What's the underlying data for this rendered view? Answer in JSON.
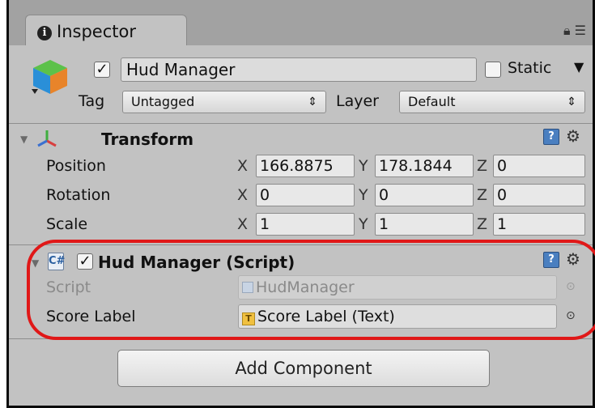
{
  "tab": {
    "title": "Inspector"
  },
  "header": {
    "object_name": "Hud Manager",
    "static_label": "Static",
    "tag_label": "Tag",
    "tag_value": "Untagged",
    "layer_label": "Layer",
    "layer_value": "Default"
  },
  "transform": {
    "title": "Transform",
    "rows": [
      {
        "label": "Position",
        "x": "166.8875",
        "y": "178.1844",
        "z": "0"
      },
      {
        "label": "Rotation",
        "x": "0",
        "y": "0",
        "z": "0"
      },
      {
        "label": "Scale",
        "x": "1",
        "y": "1",
        "z": "1"
      }
    ],
    "axis_x": "X",
    "axis_y": "Y",
    "axis_z": "Z"
  },
  "script_component": {
    "title": "Hud Manager (Script)",
    "script_label": "Script",
    "script_value": "HudManager",
    "score_label": "Score Label",
    "score_value": "Score Label (Text)"
  },
  "add_component": {
    "label": "Add Component"
  },
  "colors": {
    "highlight": "#e01818",
    "panel": "#c2c2c2"
  }
}
